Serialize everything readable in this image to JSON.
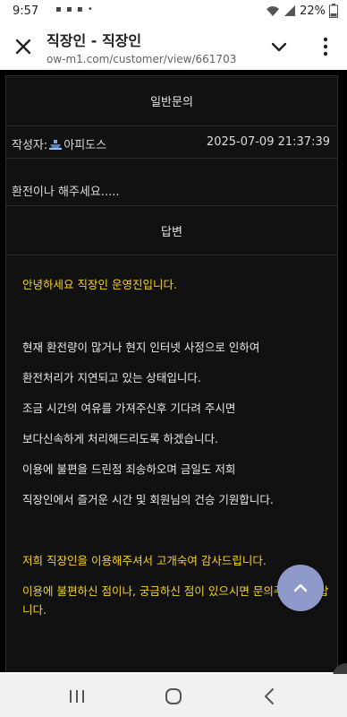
{
  "status": {
    "time": "9:57",
    "battery": "22%"
  },
  "browser": {
    "title": "직장인 - 직장인",
    "url": "ow-m1.com/customer/view/661703"
  },
  "post": {
    "category": "일반문의",
    "author_label": "작성자:",
    "author": "아피도스",
    "date": "2025-07-09 21:37:39",
    "question": "환전이나 해주세요....."
  },
  "answer": {
    "heading": "답변",
    "lines": [
      "안녕하세요 직장인 운영진입니다.",
      "현재 환전량이 많거나 현지 인터넷 사정으로 인하여",
      "환전처리가 지연되고 있는 상태입니다.",
      "조금 시간의 여유를 가져주신후 기다려 주시면",
      "보다신속하게 처리해드리도록 하겠습니다.",
      "이용에 불편을 드린점 죄송하오며 금일도 저희",
      "직장인에서 즐거운 시간 및 회원님의 건승 기원합니다.",
      "저희 직장인을 이용해주셔서 고개숙여 감사드립니다.",
      "이용에 불편하신 점이나, 궁금하신 점이 있으시면 문의주시기 바랍",
      "니다."
    ]
  },
  "colors": {
    "highlight": "#f7d21a",
    "fab": "#8e9ac9"
  },
  "icons": {
    "close": "close-icon",
    "dropdown": "chevron-down-icon",
    "menu": "more-vert-icon",
    "scroll_top": "chevron-up-icon"
  }
}
